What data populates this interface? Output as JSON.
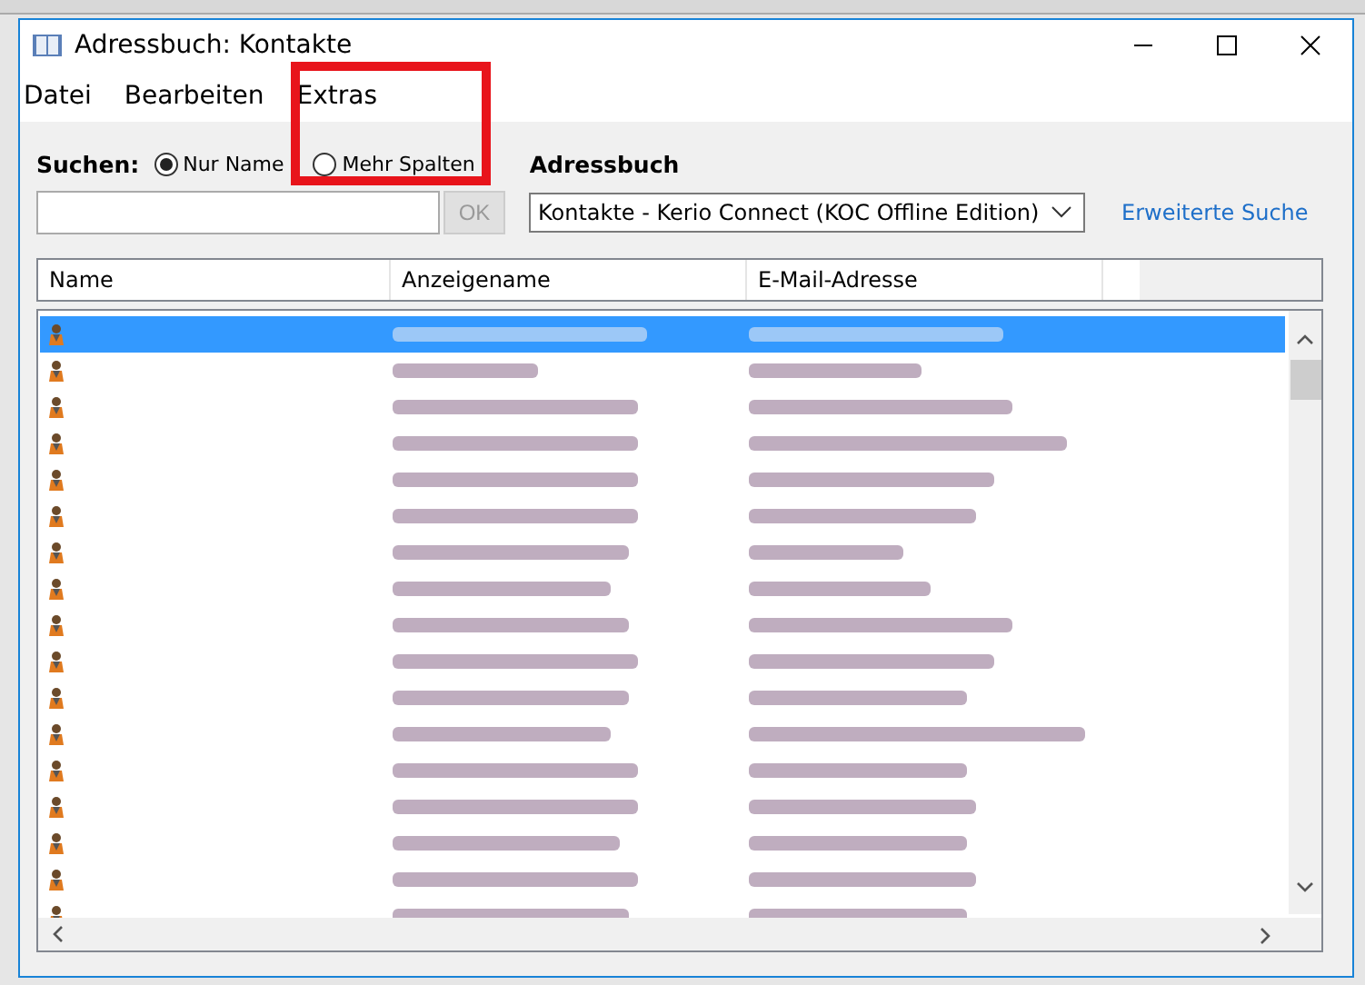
{
  "window": {
    "title": "Adressbuch: Kontakte"
  },
  "menu": [
    {
      "label": "Datei"
    },
    {
      "label": "Bearbeiten"
    },
    {
      "label": "Extras"
    }
  ],
  "search": {
    "label": "Suchen:",
    "options": [
      {
        "label": "Nur Name",
        "selected": true
      },
      {
        "label": "Mehr Spalten",
        "selected": false
      }
    ],
    "button": "OK",
    "button_disabled": true
  },
  "addressbook": {
    "label": "Adressbuch",
    "value": "Kontakte - Kerio Connect (KOC Offline Edition)",
    "link": "Erweiterte Suche"
  },
  "table": {
    "columns": [
      "Name",
      "Anzeigename",
      "E-Mail-Adresse"
    ],
    "rows": [
      {
        "selected": true
      },
      {
        "selected": false
      },
      {
        "selected": false
      },
      {
        "selected": false
      },
      {
        "selected": false
      },
      {
        "selected": false
      },
      {
        "selected": false
      },
      {
        "selected": false
      },
      {
        "selected": false
      },
      {
        "selected": false
      },
      {
        "selected": false
      },
      {
        "selected": false
      },
      {
        "selected": false
      },
      {
        "selected": false
      },
      {
        "selected": false
      },
      {
        "selected": false
      },
      {
        "selected": false
      }
    ]
  }
}
